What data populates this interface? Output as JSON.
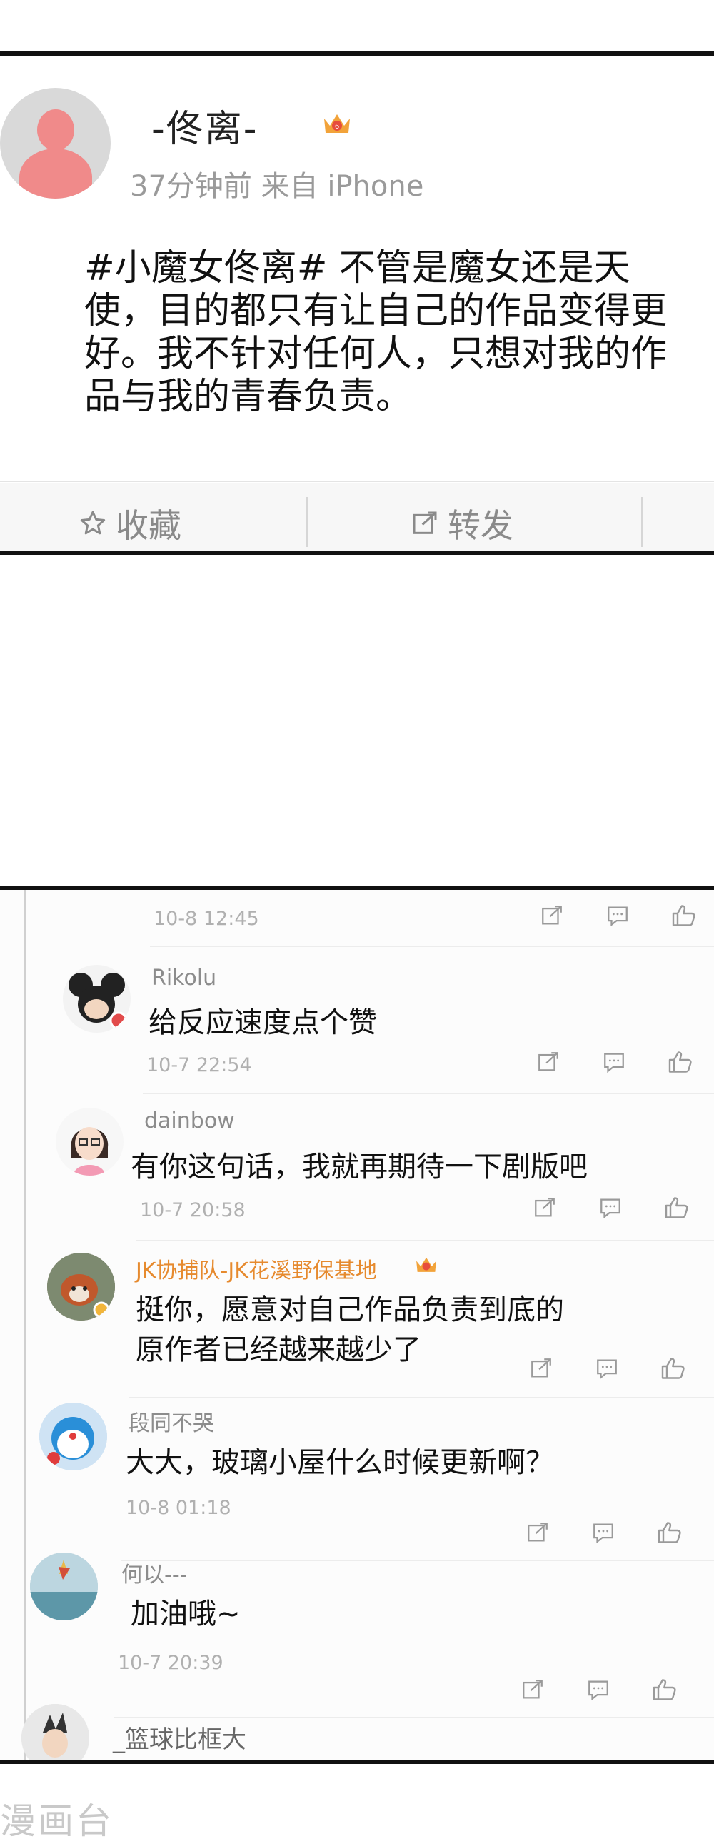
{
  "post": {
    "username": "-佟离-",
    "meta": "37分钟前 来自 iPhone",
    "text": "#小魔女佟离# 不管是魔女还是天使，目的都只有让自己的作品变得更好。我不针对任何人，只想对我的作品与我的青春负责。",
    "actions": {
      "favorite": "收藏",
      "forward": "转发"
    }
  },
  "comments": {
    "top_time": "10-8 12:45",
    "items": [
      {
        "user": "Rikolu",
        "text": "给反应速度点个赞",
        "time": "10-7 22:54"
      },
      {
        "user": "dainbow",
        "text": "有你这句话，我就再期待一下剧版吧",
        "time": "10-7 20:58"
      },
      {
        "user": "JK协捕队-JK花溪野保基地",
        "text_line1": "挺你，愿意对自己作品负责到底的",
        "text_line2": "原作者已经越来越少了",
        "time": ""
      },
      {
        "user": "段同不哭",
        "text": "大大，玻璃小屋什么时候更新啊？",
        "time": "10-8 01:18"
      },
      {
        "user": "何以---",
        "text": "加油哦~",
        "time": "10-7 20:39"
      },
      {
        "user": "_篮球比框大",
        "text": "",
        "time": ""
      }
    ]
  },
  "watermark": "漫画台",
  "colors": {
    "avatar_pink": "#f08a8a",
    "vip_orange": "#e68a2e",
    "meta_gray": "#9a9a9a"
  }
}
